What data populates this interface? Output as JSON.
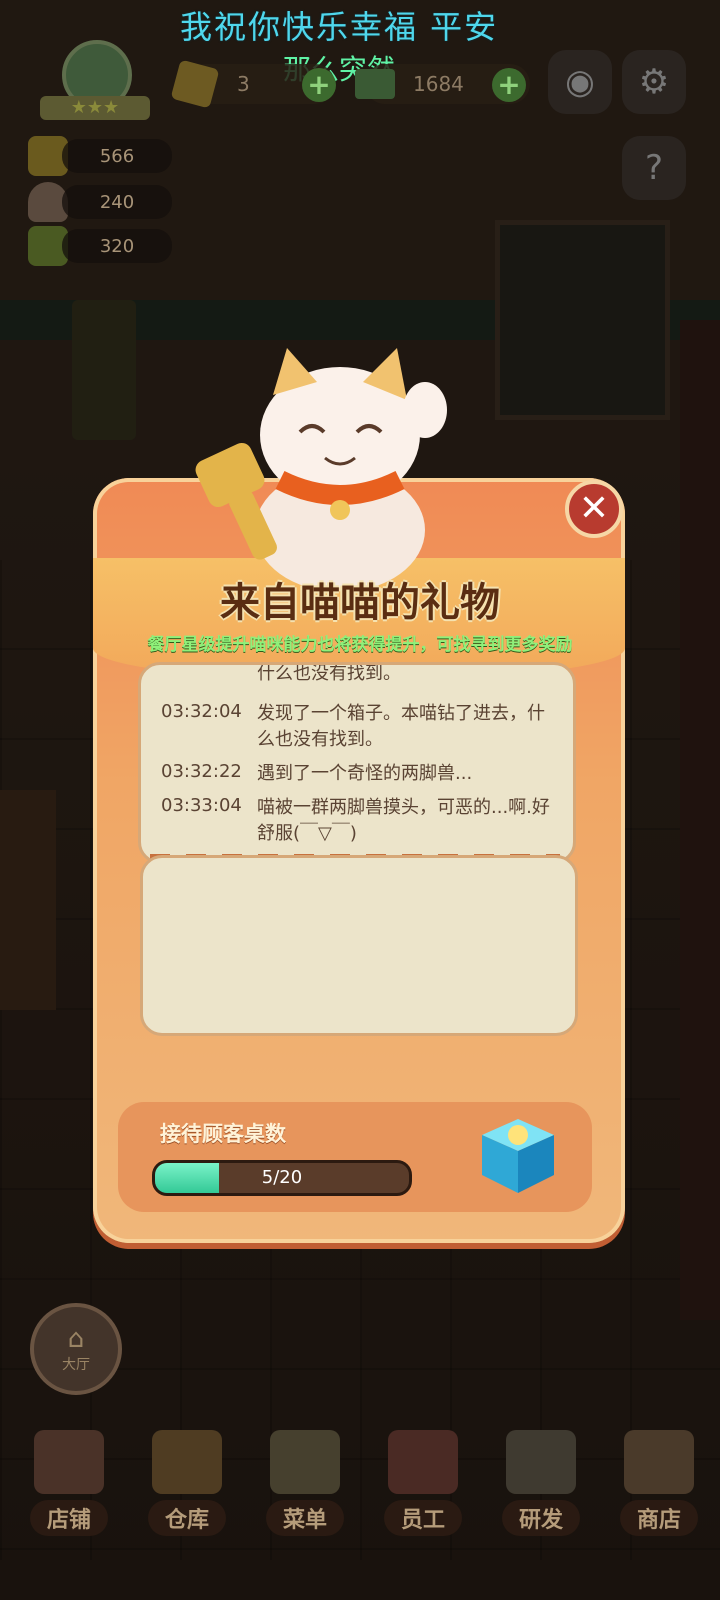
{
  "overlay_text": {
    "line1": "我祝你快乐幸福 平安",
    "line2": "那么突然"
  },
  "hud": {
    "gems": "3",
    "cash": "1684",
    "resources": [
      {
        "name": "gold-ingot",
        "value": "566"
      },
      {
        "name": "food-cover",
        "value": "240"
      },
      {
        "name": "book",
        "value": "320"
      }
    ]
  },
  "modal": {
    "title": "来自喵喵的礼物",
    "subtitle": "餐厅星级提升喵咪能力也将获得提升，可找寻到更多奖励",
    "log": [
      {
        "time": "",
        "text": "什么也没有找到。"
      },
      {
        "time": "03:32:04",
        "text": "发现了一个箱子。本喵钻了进去，什么也没有找到。"
      },
      {
        "time": "03:32:22",
        "text": "遇到了一个奇怪的两脚兽..."
      },
      {
        "time": "03:33:04",
        "text": "喵被一群两脚兽摸头，可恶的...啊.好舒服(￣▽￣)"
      }
    ],
    "progress_label": "接待顾客桌数",
    "progress_text": "5/20",
    "progress_value": 5,
    "progress_max": 20,
    "close_symbol": "✕"
  },
  "hall_label": "大厅",
  "nav": [
    {
      "label": "店铺",
      "icon": "shop-building-icon"
    },
    {
      "label": "仓库",
      "icon": "warehouse-boxes-icon"
    },
    {
      "label": "菜单",
      "icon": "menu-clipboard-icon"
    },
    {
      "label": "员工",
      "icon": "staff-chef-icon"
    },
    {
      "label": "研发",
      "icon": "research-wok-icon"
    },
    {
      "label": "商店",
      "icon": "store-stall-icon"
    }
  ],
  "colors": {
    "modal_orange": "#f08a55",
    "progress_fill": "#33c996",
    "overlay_cyan": "#4fd7ec",
    "overlay_green": "#5ff2a5"
  }
}
